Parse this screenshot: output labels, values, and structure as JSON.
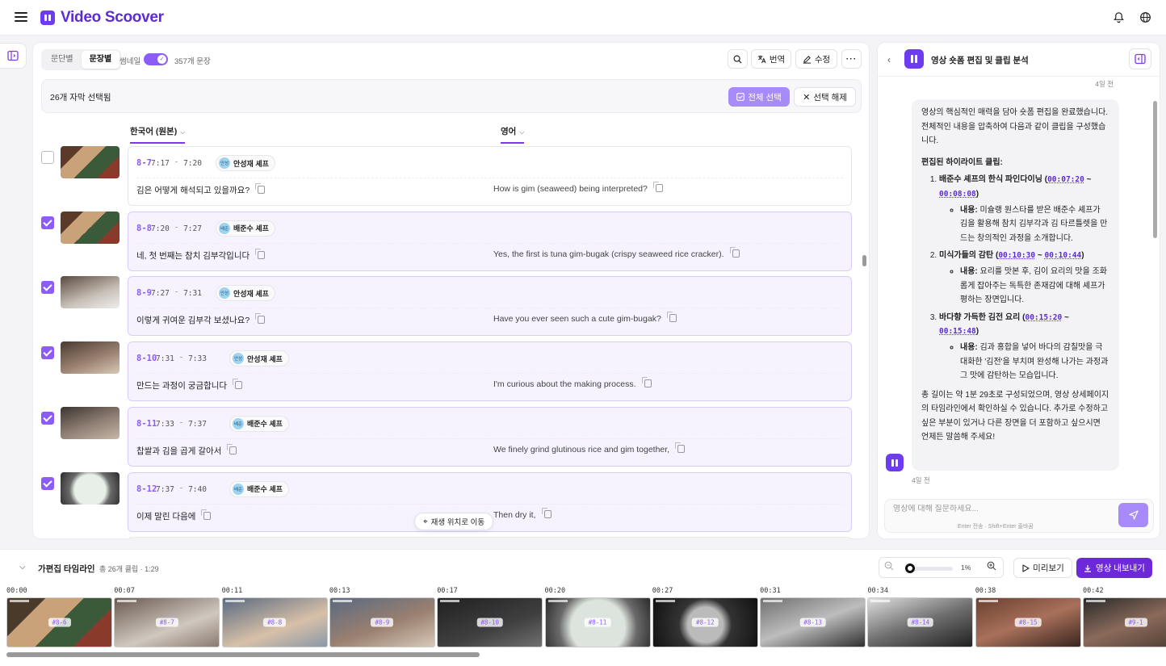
{
  "app": {
    "title": "Video Scoover",
    "accent": "#6d3cf0"
  },
  "toolbar": {
    "seg_paragraph": "문단별",
    "seg_sentence": "문장별",
    "thumbnail_label": "썸네일",
    "count_label": "357개 문장",
    "translate": "번역",
    "edit": "수정"
  },
  "selection": {
    "text": "26개 자막 선택됨",
    "select_all": "전체 선택",
    "deselect": "선택 해제"
  },
  "columns": {
    "source": "한국어 (원본)",
    "target": "영어"
  },
  "rows": [
    {
      "id": "8-7",
      "start": "7:17",
      "end": "7:20",
      "speaker": "안성재 셰프",
      "speaker_short": "안성",
      "ko": "김은 어떻게 해석되고 있을까요?",
      "en": "How is gim (seaweed) being interpreted?",
      "checked": false
    },
    {
      "id": "8-8",
      "start": "7:20",
      "end": "7:27",
      "speaker": "배준수 셰프",
      "speaker_short": "배준",
      "ko": "네, 첫 번째는 참치 김부각입니다",
      "en": "Yes, the first is tuna gim-bugak (crispy seaweed rice cracker).",
      "checked": true
    },
    {
      "id": "8-9",
      "start": "7:27",
      "end": "7:31",
      "speaker": "안성재 셰프",
      "speaker_short": "안성",
      "ko": "이렇게 귀여운 김부각 보셨나요?",
      "en": "Have you ever seen such a cute gim-bugak?",
      "checked": true
    },
    {
      "id": "8-10",
      "start": "7:31",
      "end": "7:33",
      "speaker": "안성재 셰프",
      "speaker_short": "안성",
      "ko": "만드는 과정이 궁금합니다",
      "en": "I'm curious about the making process.",
      "checked": true
    },
    {
      "id": "8-11",
      "start": "7:33",
      "end": "7:37",
      "speaker": "배준수 셰프",
      "speaker_short": "배준",
      "ko": "찹쌀과 김을 곱게 갈아서",
      "en": "We finely grind glutinous rice and gim together,",
      "checked": true
    },
    {
      "id": "8-12",
      "start": "7:37",
      "end": "7:40",
      "speaker": "배준수 셰프",
      "speaker_short": "배준",
      "ko": "이제 말린 다음에",
      "en": "Then dry it,",
      "checked": true
    }
  ],
  "jump_label": "재생 위치로 이동",
  "chat": {
    "title": "영상 숏폼 편집 및 클립 분석",
    "time_top": "4일 전",
    "time_bottom": "4일 전",
    "intro": "영상의 핵심적인 매력을 담아 숏폼 편집을 완료했습니다. 전체적인 내용을 압축하여 다음과 같이 클립을 구성했습니다.",
    "highlights_title": "편집된 하이라이트 클립:",
    "items": [
      {
        "title": "배준수 셰프의 한식 파인다이닝",
        "t1": "00:07:20",
        "t2": "00:08:08",
        "label": "내용:",
        "desc": "미슐랭 원스타를 받은 배준수 셰프가 김을 활용해 참치 김부각과 김 타르틀렛을 만드는 창의적인 과정을 소개합니다."
      },
      {
        "title": "미식가들의 감탄",
        "t1": "00:10:30",
        "t2": "00:10:44",
        "label": "내용:",
        "desc": "요리를 맛본 후, 김이 요리의 맛을 조화롭게 잡아주는 독특한 존재감에 대해 셰프가 평하는 장면입니다."
      },
      {
        "title": "바다향 가득한 김전 요리",
        "t1": "00:15:20",
        "t2": "00:15:48",
        "label": "내용:",
        "desc": "김과 홍합을 넣어 바다의 감칠맛을 극대화한 '김전'을 부치며 완성해 나가는 과정과 그 맛에 감탄하는 모습입니다."
      }
    ],
    "outro": "총 길이는 약 1분 29초로 구성되었으며, 영상 상세페이지의 타임라인에서 확인하실 수 있습니다. 추가로 수정하고 싶은 부분이 있거나 다른 장면을 더 포함하고 싶으시면 언제든 말씀해 주세요!",
    "input_placeholder": "영상에 대해 질문하세요...",
    "input_hint": "Enter 전송 · Shift+Enter 줄바꿈"
  },
  "timeline": {
    "title": "가편집 타임라인",
    "meta": "총 26개 클립 · 1:29",
    "zoom_pct": "1%",
    "zoom_value": 0.01,
    "preview": "미리보기",
    "export": "영상 내보내기",
    "ticks": [
      "00:00",
      "00:07",
      "00:11",
      "00:13",
      "00:17",
      "00:20",
      "00:27",
      "00:31",
      "00:34",
      "00:38",
      "00:42"
    ],
    "clips": [
      "#8-6",
      "#8-7",
      "#8-8",
      "#8-9",
      "#8-10",
      "#8-11",
      "#8-12",
      "#8-13",
      "#8-14",
      "#8-15",
      "#9-1"
    ]
  }
}
